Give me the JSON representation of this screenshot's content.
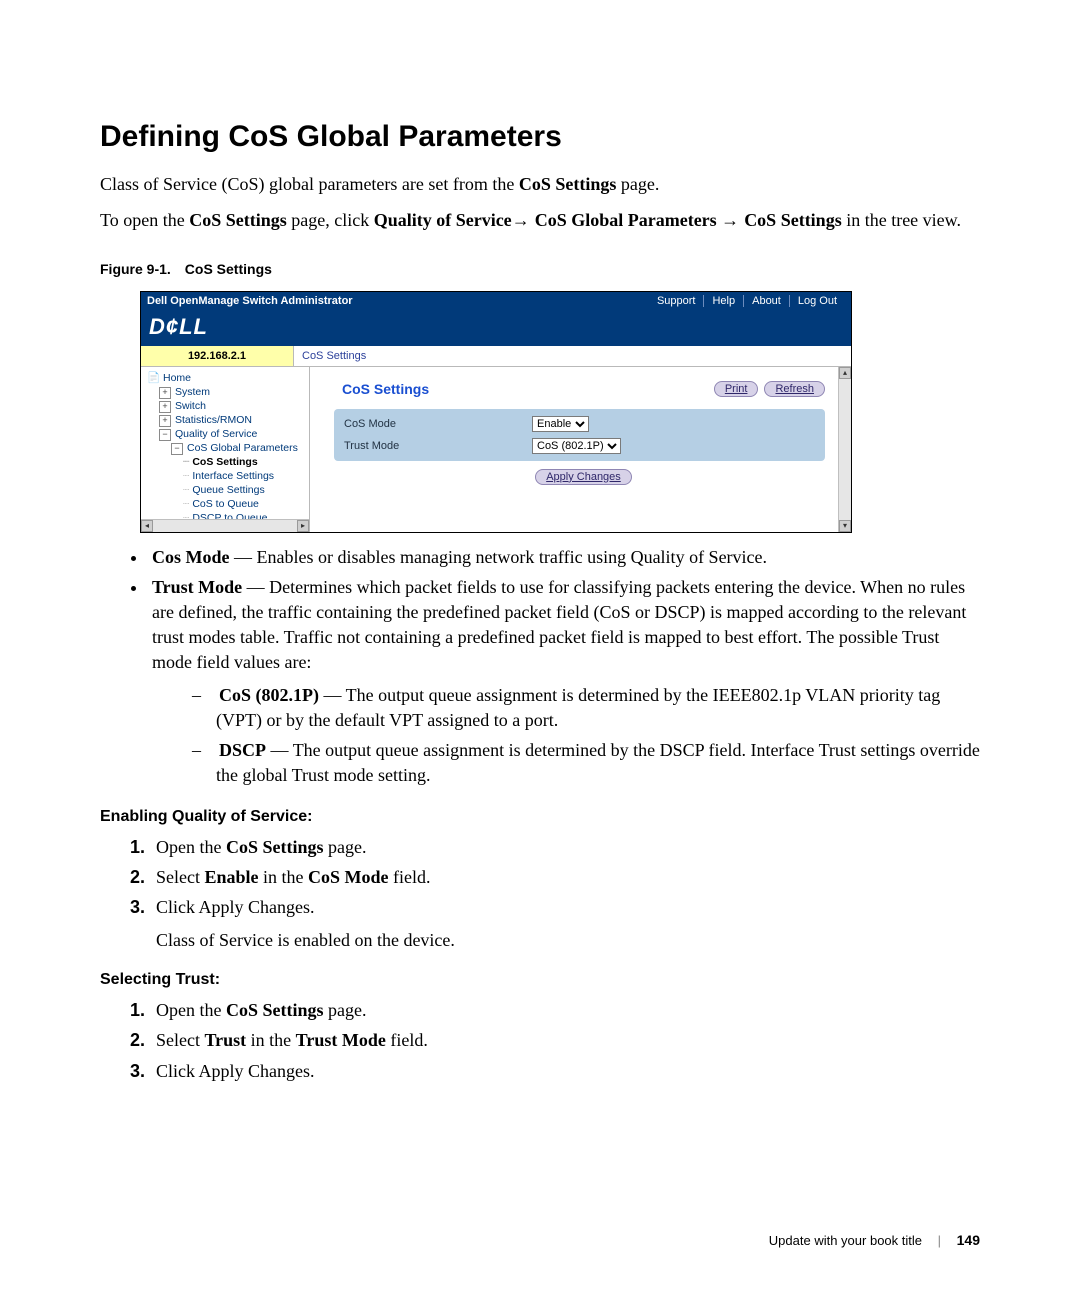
{
  "heading": "Defining CoS Global Parameters",
  "intro1_pre": "Class of Service (CoS) global parameters are set from the ",
  "intro1_bold": "CoS Settings",
  "intro1_post": " page.",
  "intro2_a": "To open the ",
  "intro2_b": "CoS Settings",
  "intro2_c": " page, click ",
  "intro2_d": "Quality of Service",
  "intro2_e": "→ ",
  "intro2_f": "CoS Global Parameters ",
  "intro2_g": "→ ",
  "intro2_h": "CoS Settings",
  "intro2_i": " in the tree view.",
  "figure_num": "Figure 9-1.",
  "figure_title": "CoS Settings",
  "screenshot": {
    "app_title": "Dell OpenManage Switch Administrator",
    "toplinks": [
      "Support",
      "Help",
      "About",
      "Log Out"
    ],
    "logo": "D¢LL",
    "ip": "192.168.2.1",
    "breadcrumb": "CoS Settings",
    "tree": {
      "home": "Home",
      "system": "System",
      "switch": "Switch",
      "stats": "Statistics/RMON",
      "qos": "Quality of Service",
      "cosgp": "CoS Global Parameters",
      "cos_settings": "CoS Settings",
      "iface": "Interface Settings",
      "queue": "Queue Settings",
      "c2q": "CoS to Queue",
      "d2q": "DSCP to Queue"
    },
    "panel_title": "CoS Settings",
    "buttons": {
      "print": "Print",
      "refresh": "Refresh",
      "apply": "Apply Changes"
    },
    "form": {
      "row1_label": "CoS Mode",
      "row1_value": "Enable",
      "row2_label": "Trust Mode",
      "row2_value": "CoS (802.1P)"
    }
  },
  "bullet1_b": "Cos Mode",
  "bullet1_t": " — Enables or disables managing network traffic using Quality of Service.",
  "bullet2_b": "Trust Mode",
  "bullet2_t": " — Determines which packet fields to use for classifying packets entering the device. When no rules are defined, the traffic containing the predefined packet field (CoS or DSCP) is mapped according to the relevant trust modes table. Traffic not containing a predefined packet field is mapped to best effort. The possible Trust mode field values are:",
  "dash1_b": "CoS (802.1P)",
  "dash1_t": " — The output queue assignment is determined by the IEEE802.1p VLAN priority tag (VPT) or by the default VPT assigned to a port.",
  "dash2_b": "DSCP",
  "dash2_t": " — The output queue assignment is determined by the DSCP field. Interface Trust settings override the global Trust mode setting.",
  "enable_head": "Enabling Quality of Service:",
  "enable_s1a": "Open the ",
  "enable_s1b": "CoS Settings",
  "enable_s1c": " page.",
  "enable_s2a": "Select ",
  "enable_s2b": "Enable",
  "enable_s2c": " in the ",
  "enable_s2d": "CoS Mode",
  "enable_s2e": " field.",
  "enable_s3": "Click Apply Changes.",
  "enable_note": "Class of Service is enabled on the device.",
  "trust_head": "Selecting Trust:",
  "trust_s1a": "Open the ",
  "trust_s1b": "CoS Settings",
  "trust_s1c": " page.",
  "trust_s2a": "Select ",
  "trust_s2b": "Trust",
  "trust_s2c": " in the ",
  "trust_s2d": "Trust Mode",
  "trust_s2e": " field.",
  "trust_s3": "Click Apply Changes.",
  "footer_title": "Update with your book title",
  "footer_page": "149"
}
